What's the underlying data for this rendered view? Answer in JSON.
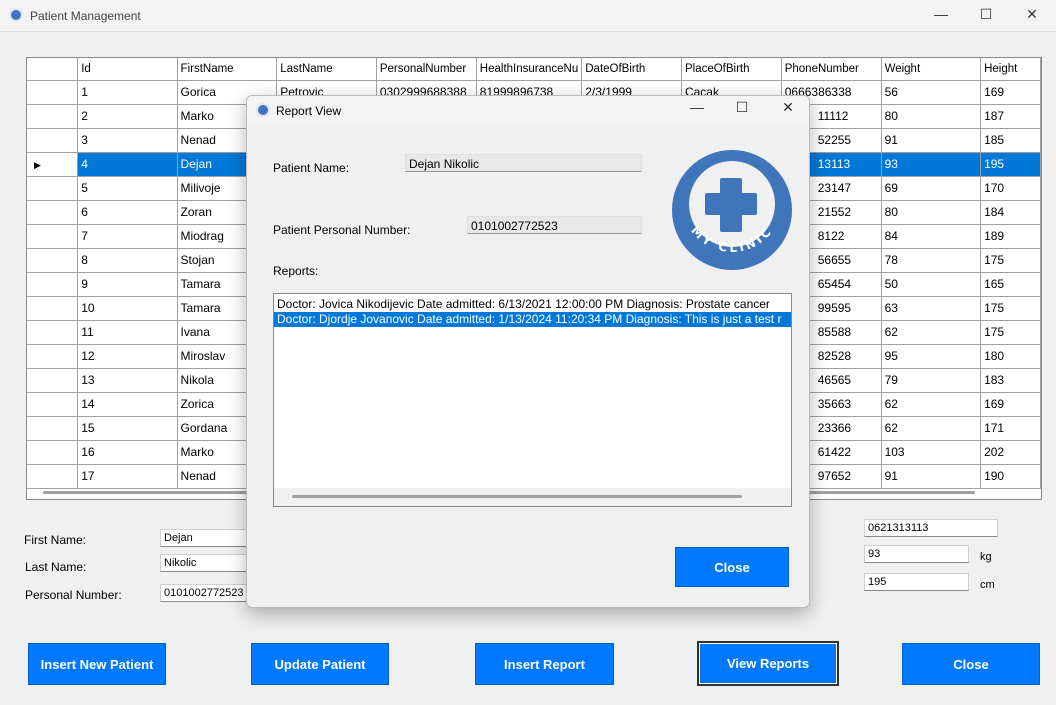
{
  "window": {
    "title": "Patient Management",
    "minimize": "—",
    "maximize": "☐",
    "close": "✕"
  },
  "grid": {
    "columns": [
      "Id",
      "FirstName",
      "LastName",
      "PersonalNumber",
      "HealthInsuranceNu",
      "DateOfBirth",
      "PlaceOfBirth",
      "PhoneNumber",
      "Weight",
      "Height"
    ],
    "selected_row": 4,
    "rows": [
      [
        "1",
        "Gorica",
        "Petrovic",
        "0302999688388",
        "81999896738",
        "2/3/1999",
        "Cacak",
        "0666386338",
        "56",
        "169"
      ],
      [
        "2",
        "Marko",
        "",
        "",
        "",
        "",
        "",
        "11112",
        "80",
        "187"
      ],
      [
        "3",
        "Nenad",
        "",
        "",
        "",
        "",
        "",
        "52255",
        "91",
        "185"
      ],
      [
        "4",
        "Dejan",
        "",
        "",
        "",
        "",
        "",
        "13113",
        "93",
        "195"
      ],
      [
        "5",
        "Milivoje",
        "",
        "",
        "",
        "",
        "",
        "23147",
        "69",
        "170"
      ],
      [
        "6",
        "Zoran",
        "",
        "",
        "",
        "",
        "",
        "21552",
        "80",
        "184"
      ],
      [
        "7",
        "Miodrag",
        "",
        "",
        "",
        "",
        "",
        "8122",
        "84",
        "189"
      ],
      [
        "8",
        "Stojan",
        "",
        "",
        "",
        "",
        "",
        "56655",
        "78",
        "175"
      ],
      [
        "9",
        "Tamara",
        "",
        "",
        "",
        "",
        "",
        "65454",
        "50",
        "165"
      ],
      [
        "10",
        "Tamara",
        "",
        "",
        "",
        "",
        "",
        "99595",
        "63",
        "175"
      ],
      [
        "11",
        "Ivana",
        "",
        "",
        "",
        "",
        "",
        "85588",
        "62",
        "175"
      ],
      [
        "12",
        "Miroslav",
        "",
        "",
        "",
        "",
        "",
        "82528",
        "95",
        "180"
      ],
      [
        "13",
        "Nikola",
        "",
        "",
        "",
        "",
        "",
        "46565",
        "79",
        "183"
      ],
      [
        "14",
        "Zorica",
        "",
        "",
        "",
        "",
        "",
        "35663",
        "62",
        "169"
      ],
      [
        "15",
        "Gordana",
        "",
        "",
        "",
        "",
        "",
        "23366",
        "62",
        "171"
      ],
      [
        "16",
        "Marko",
        "",
        "",
        "",
        "",
        "",
        "61422",
        "103",
        "202"
      ],
      [
        "17",
        "Nenad",
        "",
        "",
        "",
        "",
        "",
        "97652",
        "91",
        "190"
      ]
    ]
  },
  "form": {
    "first_name_label": "First Name:",
    "first_name": "Dejan",
    "last_name_label": "Last Name:",
    "last_name": "Nikolic",
    "personal_number_label": "Personal Number:",
    "personal_number": "0101002772523",
    "phone": "0621313113",
    "weight": "93",
    "weight_unit": "kg",
    "height": "195",
    "height_unit": "cm"
  },
  "buttons": {
    "insert_patient": "Insert New Patient",
    "update_patient": "Update Patient",
    "insert_report": "Insert Report",
    "view_reports": "View Reports",
    "close": "Close"
  },
  "dialog": {
    "title": "Report View",
    "patient_name_label": "Patient Name:",
    "patient_name": "Dejan Nikolic",
    "personal_number_label": "Patient Personal Number:",
    "personal_number": "0101002772523",
    "reports_label": "Reports:",
    "reports": [
      "Doctor: Jovica Nikodijevic Date admitted: 6/13/2021 12:00:00 PM Diagnosis: Prostate cancer",
      "Doctor: Djordje Jovanovic Date admitted: 1/13/2024 11:20:34 PM Diagnosis: This is just a test r"
    ],
    "selected_report": 1,
    "close": "Close",
    "logo_text": "MY CLINIC"
  },
  "colors": {
    "accent": "#0078ff",
    "selection": "#0078d7",
    "logo": "#3f75bb"
  }
}
